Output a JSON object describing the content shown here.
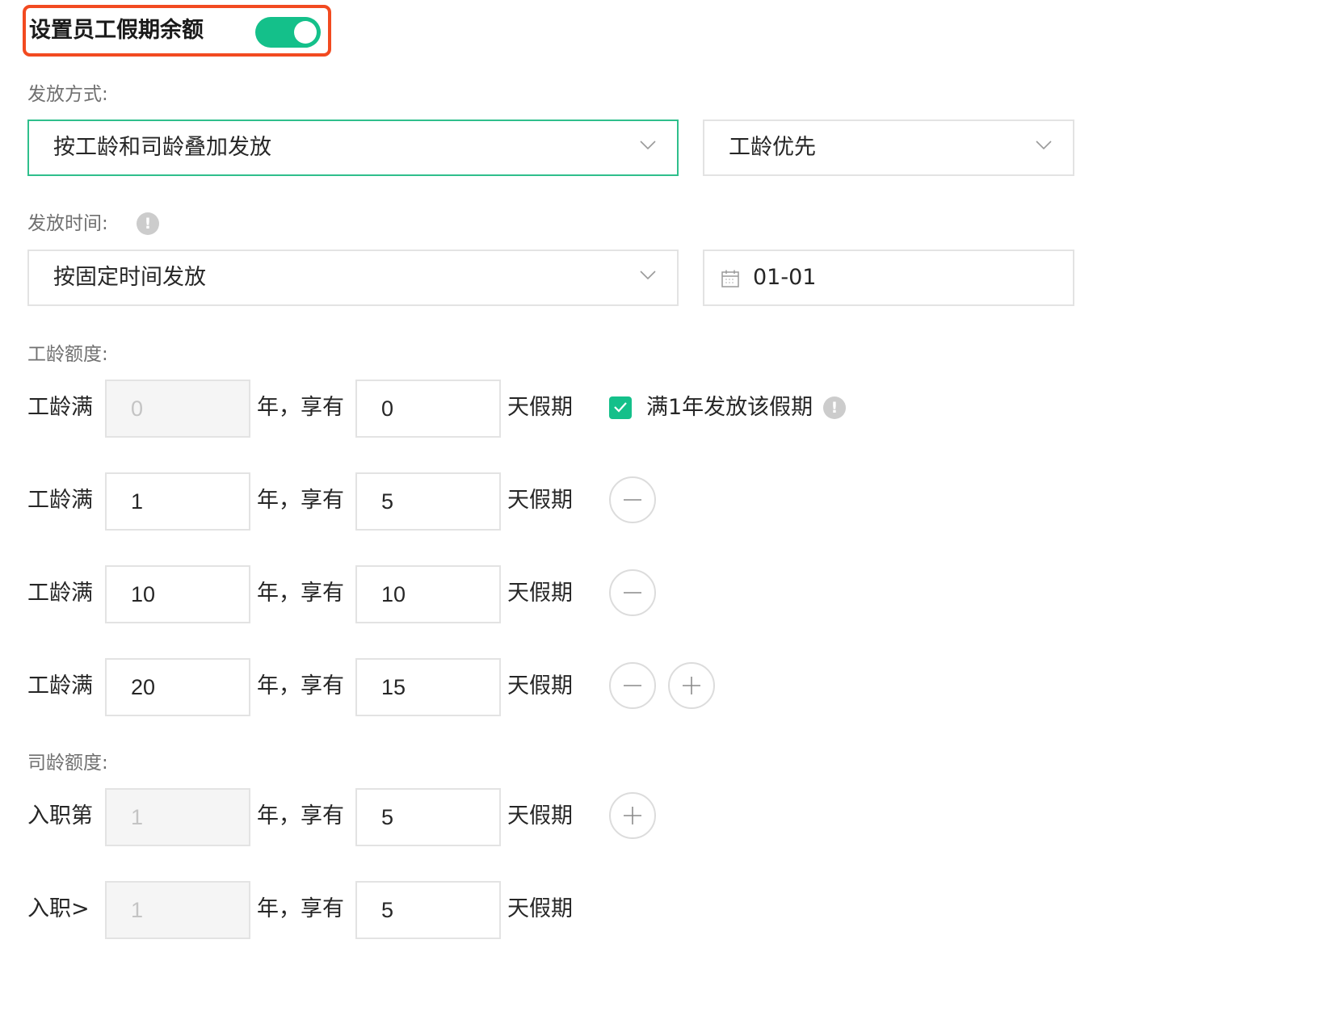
{
  "header": {
    "title": "设置员工假期余额",
    "toggle_on": true
  },
  "distribution": {
    "label": "发放方式:",
    "method": "按工龄和司龄叠加发放",
    "priority": "工龄优先"
  },
  "timing": {
    "label": "发放时间:",
    "method": "按固定时间发放",
    "date": "01-01",
    "help_glyph": "!"
  },
  "work_age": {
    "label": "工龄额度:",
    "rows": [
      {
        "prefix": "工龄满",
        "years": "0",
        "unit1": "年，享有",
        "days": "0",
        "unit2": "天假期"
      },
      {
        "prefix": "工龄满",
        "years": "1",
        "unit1": "年，享有",
        "days": "5",
        "unit2": "天假期"
      },
      {
        "prefix": "工龄满",
        "years": "10",
        "unit1": "年，享有",
        "days": "10",
        "unit2": "天假期"
      },
      {
        "prefix": "工龄满",
        "years": "20",
        "unit1": "年，享有",
        "days": "15",
        "unit2": "天假期"
      }
    ],
    "checkbox_label": "满1年发放该假期",
    "help_glyph": "!"
  },
  "company_age": {
    "label": "司龄额度:",
    "rows": [
      {
        "prefix": "入职第",
        "years": "1",
        "unit1": "年，享有",
        "days": "5",
        "unit2": "天假期"
      },
      {
        "prefix": "入职>",
        "years": "1",
        "unit1": "年，享有",
        "days": "5",
        "unit2": "天假期"
      }
    ]
  },
  "colors": {
    "accent": "#14c08a",
    "highlight": "#f24a20",
    "border": "#e3e3e3",
    "muted": "#707070"
  },
  "icons": [
    "chevron-down-icon",
    "calendar-icon",
    "help-icon",
    "check-icon",
    "minus-icon",
    "plus-icon"
  ]
}
